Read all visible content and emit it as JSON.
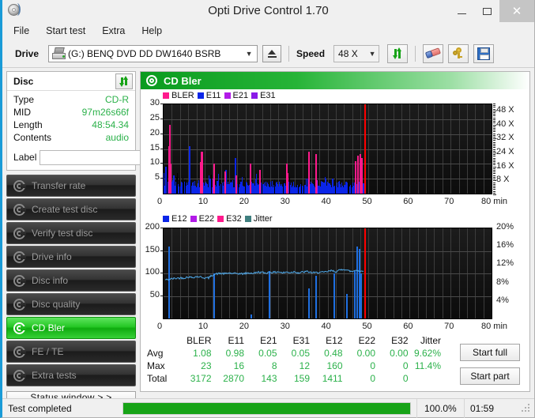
{
  "window": {
    "title": "Opti Drive Control 1.70",
    "icon": "disc-icon",
    "buttons": {
      "minimize": "–",
      "maximize": "□",
      "close": "✕"
    }
  },
  "menu": {
    "items": [
      "File",
      "Start test",
      "Extra",
      "Help"
    ]
  },
  "toolbar": {
    "drive_label": "Drive",
    "drive_value": "(G:)   BENQ DVD DD DW1640 BSRB",
    "eject_title": "Eject",
    "speed_label": "Speed",
    "speed_value": "48 X",
    "refresh_title": "refresh-icon",
    "erase_title": "erase-icon",
    "keys_title": "keys-icon",
    "save_title": "save-icon"
  },
  "sidebar": {
    "disc_panel": {
      "title": "Disc",
      "refresh_title": "refresh-icon",
      "rows": [
        {
          "key": "Type",
          "value": "CD-R"
        },
        {
          "key": "MID",
          "value": "97m26s66f"
        },
        {
          "key": "Length",
          "value": "48:54.34"
        },
        {
          "key": "Contents",
          "value": "audio"
        }
      ],
      "label_key": "Label",
      "label_value": "",
      "label_placeholder": ""
    },
    "tests": [
      {
        "label": "Transfer rate",
        "active": false
      },
      {
        "label": "Create test disc",
        "active": false
      },
      {
        "label": "Verify test disc",
        "active": false
      },
      {
        "label": "Drive info",
        "active": false
      },
      {
        "label": "Disc info",
        "active": false
      },
      {
        "label": "Disc quality",
        "active": false
      },
      {
        "label": "CD Bler",
        "active": true
      },
      {
        "label": "FE / TE",
        "active": false
      },
      {
        "label": "Extra tests",
        "active": false
      }
    ],
    "status_window_button": "Status window > >"
  },
  "content": {
    "header_title": "CD Bler",
    "header_icon": "target-icon"
  },
  "stats": {
    "columns": [
      "BLER",
      "E11",
      "E21",
      "E31",
      "E12",
      "E22",
      "E32",
      "Jitter"
    ],
    "rows": [
      {
        "label": "Avg",
        "values": [
          "1.08",
          "0.98",
          "0.05",
          "0.05",
          "0.48",
          "0.00",
          "0.00",
          "9.62%"
        ]
      },
      {
        "label": "Max",
        "values": [
          "23",
          "16",
          "8",
          "12",
          "160",
          "0",
          "0",
          "11.4%"
        ]
      },
      {
        "label": "Total",
        "values": [
          "3172",
          "2870",
          "143",
          "159",
          "1411",
          "0",
          "0",
          ""
        ]
      }
    ],
    "start_full": "Start full",
    "start_part": "Start part"
  },
  "statusbar": {
    "message": "Test completed",
    "progress_percent": "100.0%",
    "progress_value": 100,
    "elapsed": "01:59"
  },
  "colors": {
    "bler": "#ff1a8c",
    "e11": "#0a25e8",
    "e21": "#b21ae8",
    "e31": "#8a1ae8",
    "e12": "#0a25e8",
    "e22": "#b21ae8",
    "e32": "#ff1a8c",
    "jitter": "#3f7f7f",
    "speed_line": "#4fa8e8",
    "end_marker": "#ff0000",
    "accent_green": "#17a317",
    "value_green": "#2bb14a"
  },
  "chart_data": [
    {
      "type": "line",
      "name": "bler-chart",
      "title": "CD Bler",
      "xlabel": "min",
      "ylabel": "",
      "xlim": [
        0,
        80
      ],
      "ylim": [
        0,
        30
      ],
      "xticks": [
        0,
        10,
        20,
        30,
        40,
        50,
        60,
        70,
        80
      ],
      "xticklabels": [
        "0",
        "10",
        "20",
        "30",
        "40",
        "50",
        "60",
        "70",
        "80 min"
      ],
      "yticks": [
        5,
        10,
        15,
        20,
        25,
        30
      ],
      "y2lim": [
        0,
        52
      ],
      "y2ticks": [
        8,
        16,
        24,
        32,
        40,
        48
      ],
      "y2ticklabels": [
        "8 X",
        "16 X",
        "24 X",
        "32 X",
        "40 X",
        "48 X"
      ],
      "grid": true,
      "legend": [
        {
          "name": "BLER",
          "color": "#ff1a8c"
        },
        {
          "name": "E11",
          "color": "#0a25e8"
        },
        {
          "name": "E21",
          "color": "#b21ae8"
        },
        {
          "name": "E31",
          "color": "#8a1ae8"
        }
      ],
      "legend_position": "top-left",
      "data_end_min": 49,
      "series": [
        {
          "name": "BLER",
          "color": "#ff1a8c",
          "peaks": [
            [
              1.3,
              23
            ],
            [
              1.2,
              16
            ],
            [
              1.5,
              10
            ],
            [
              8.9,
              10.5
            ],
            [
              9.1,
              14.2
            ],
            [
              9.3,
              14
            ],
            [
              12.1,
              10
            ],
            [
              14.9,
              7.5
            ],
            [
              17.5,
              6
            ],
            [
              21.1,
              10
            ],
            [
              23.4,
              8
            ],
            [
              29.8,
              10
            ],
            [
              30.1,
              7
            ],
            [
              35.2,
              14.2
            ],
            [
              37.1,
              13.2
            ],
            [
              46.6,
              11
            ],
            [
              47.3,
              12.8
            ],
            [
              47.9,
              13.2
            ],
            [
              48.2,
              12.0
            ]
          ]
        },
        {
          "name": "E11",
          "color": "#0a25e8",
          "description": "Dense blue band averaging ~1-3 across 0-49 min with spikes",
          "peaks": [
            [
              0.4,
              9
            ],
            [
              1.2,
              7
            ],
            [
              2.3,
              6
            ],
            [
              6.1,
              16
            ],
            [
              8.9,
              9
            ],
            [
              11.2,
              5
            ],
            [
              15.0,
              8
            ],
            [
              17.4,
              12
            ],
            [
              23.3,
              6
            ],
            [
              30.1,
              7
            ],
            [
              35.1,
              5
            ],
            [
              41.0,
              5
            ],
            [
              47.8,
              7
            ]
          ],
          "baseline": 2.2
        },
        {
          "name": "E21",
          "color": "#b21ae8",
          "peaks": [
            [
              1.4,
              4
            ],
            [
              9.2,
              4
            ],
            [
              12.0,
              5
            ],
            [
              37.2,
              4.5
            ]
          ]
        },
        {
          "name": "E31",
          "color": "#8a1ae8",
          "peaks": [
            [
              1.3,
              3
            ],
            [
              9.1,
              3
            ]
          ]
        }
      ],
      "speed_curve": {
        "name": "speed",
        "color": "#4fa8e8",
        "note": "not visible in upper chart"
      },
      "end_marker_min": 49
    },
    {
      "type": "line",
      "name": "e12-jitter-chart",
      "title": "",
      "xlabel": "min",
      "ylabel": "",
      "xlim": [
        0,
        80
      ],
      "ylim": [
        0,
        200
      ],
      "xticks": [
        0,
        10,
        20,
        30,
        40,
        50,
        60,
        70,
        80
      ],
      "xticklabels": [
        "0",
        "10",
        "20",
        "30",
        "40",
        "50",
        "60",
        "70",
        "80 min"
      ],
      "yticks": [
        50,
        100,
        150,
        200
      ],
      "y2lim": [
        0,
        20
      ],
      "y2ticks": [
        4,
        8,
        12,
        16,
        20
      ],
      "y2ticklabels": [
        "4%",
        "8%",
        "12%",
        "16%",
        "20%"
      ],
      "grid": true,
      "legend": [
        {
          "name": "E12",
          "color": "#0a25e8"
        },
        {
          "name": "E22",
          "color": "#b21ae8"
        },
        {
          "name": "E32",
          "color": "#ff1a8c"
        },
        {
          "name": "Jitter",
          "color": "#3f7f7f"
        }
      ],
      "legend_position": "top-left",
      "data_end_min": 49,
      "series": [
        {
          "name": "E12",
          "color": "#0a25e8",
          "peaks": [
            [
              1.1,
              160
            ],
            [
              1.2,
              48
            ],
            [
              12.2,
              100
            ],
            [
              21.3,
              8
            ],
            [
              25.6,
              105
            ],
            [
              35.3,
              66
            ],
            [
              37.0,
              95
            ],
            [
              41.5,
              100
            ],
            [
              44.6,
              55
            ],
            [
              46.5,
              105
            ],
            [
              47.1,
              160
            ],
            [
              47.6,
              155
            ],
            [
              48.0,
              100
            ]
          ]
        },
        {
          "name": "E22",
          "color": "#b21ae8",
          "peaks": []
        },
        {
          "name": "E32",
          "color": "#ff1a8c",
          "peaks": []
        }
      ],
      "jitter_curve": {
        "name": "Jitter",
        "color": "#4fa8e8",
        "note": "Light-blue trace, ~8.6% rising to ~10.5% across 0-49 min",
        "points": [
          [
            0.3,
            86
          ],
          [
            1.0,
            86
          ],
          [
            2.0,
            88
          ],
          [
            3.0,
            89
          ],
          [
            4.0,
            90
          ],
          [
            5.0,
            90
          ],
          [
            6.0,
            92
          ],
          [
            7.0,
            91
          ],
          [
            8.0,
            93
          ],
          [
            9.0,
            92
          ],
          [
            10.0,
            90
          ],
          [
            11.0,
            90
          ],
          [
            12.0,
            97
          ],
          [
            13.0,
            99
          ],
          [
            14.0,
            100
          ],
          [
            15.0,
            99
          ],
          [
            16.0,
            101
          ],
          [
            17.0,
            99
          ],
          [
            18.0,
            100
          ],
          [
            19.0,
            99
          ],
          [
            20.0,
            100
          ],
          [
            21.0,
            101
          ],
          [
            22.0,
            100
          ],
          [
            23.0,
            103
          ],
          [
            24.0,
            102
          ],
          [
            25.0,
            101
          ],
          [
            26.0,
            103
          ],
          [
            27.0,
            102
          ],
          [
            28.0,
            104
          ],
          [
            29.0,
            101
          ],
          [
            30.0,
            103
          ],
          [
            31.0,
            102
          ],
          [
            32.0,
            104
          ],
          [
            33.0,
            101
          ],
          [
            34.0,
            103
          ],
          [
            35.0,
            104
          ],
          [
            36.0,
            102
          ],
          [
            37.0,
            101
          ],
          [
            38.0,
            103
          ],
          [
            39.0,
            102
          ],
          [
            40.0,
            104
          ],
          [
            41.0,
            106
          ],
          [
            42.0,
            104
          ],
          [
            43.0,
            107
          ],
          [
            44.0,
            110
          ],
          [
            45.0,
            106
          ],
          [
            46.0,
            104
          ],
          [
            47.0,
            108
          ],
          [
            48.0,
            104
          ],
          [
            48.8,
            107
          ]
        ]
      },
      "end_marker_min": 49
    }
  ]
}
